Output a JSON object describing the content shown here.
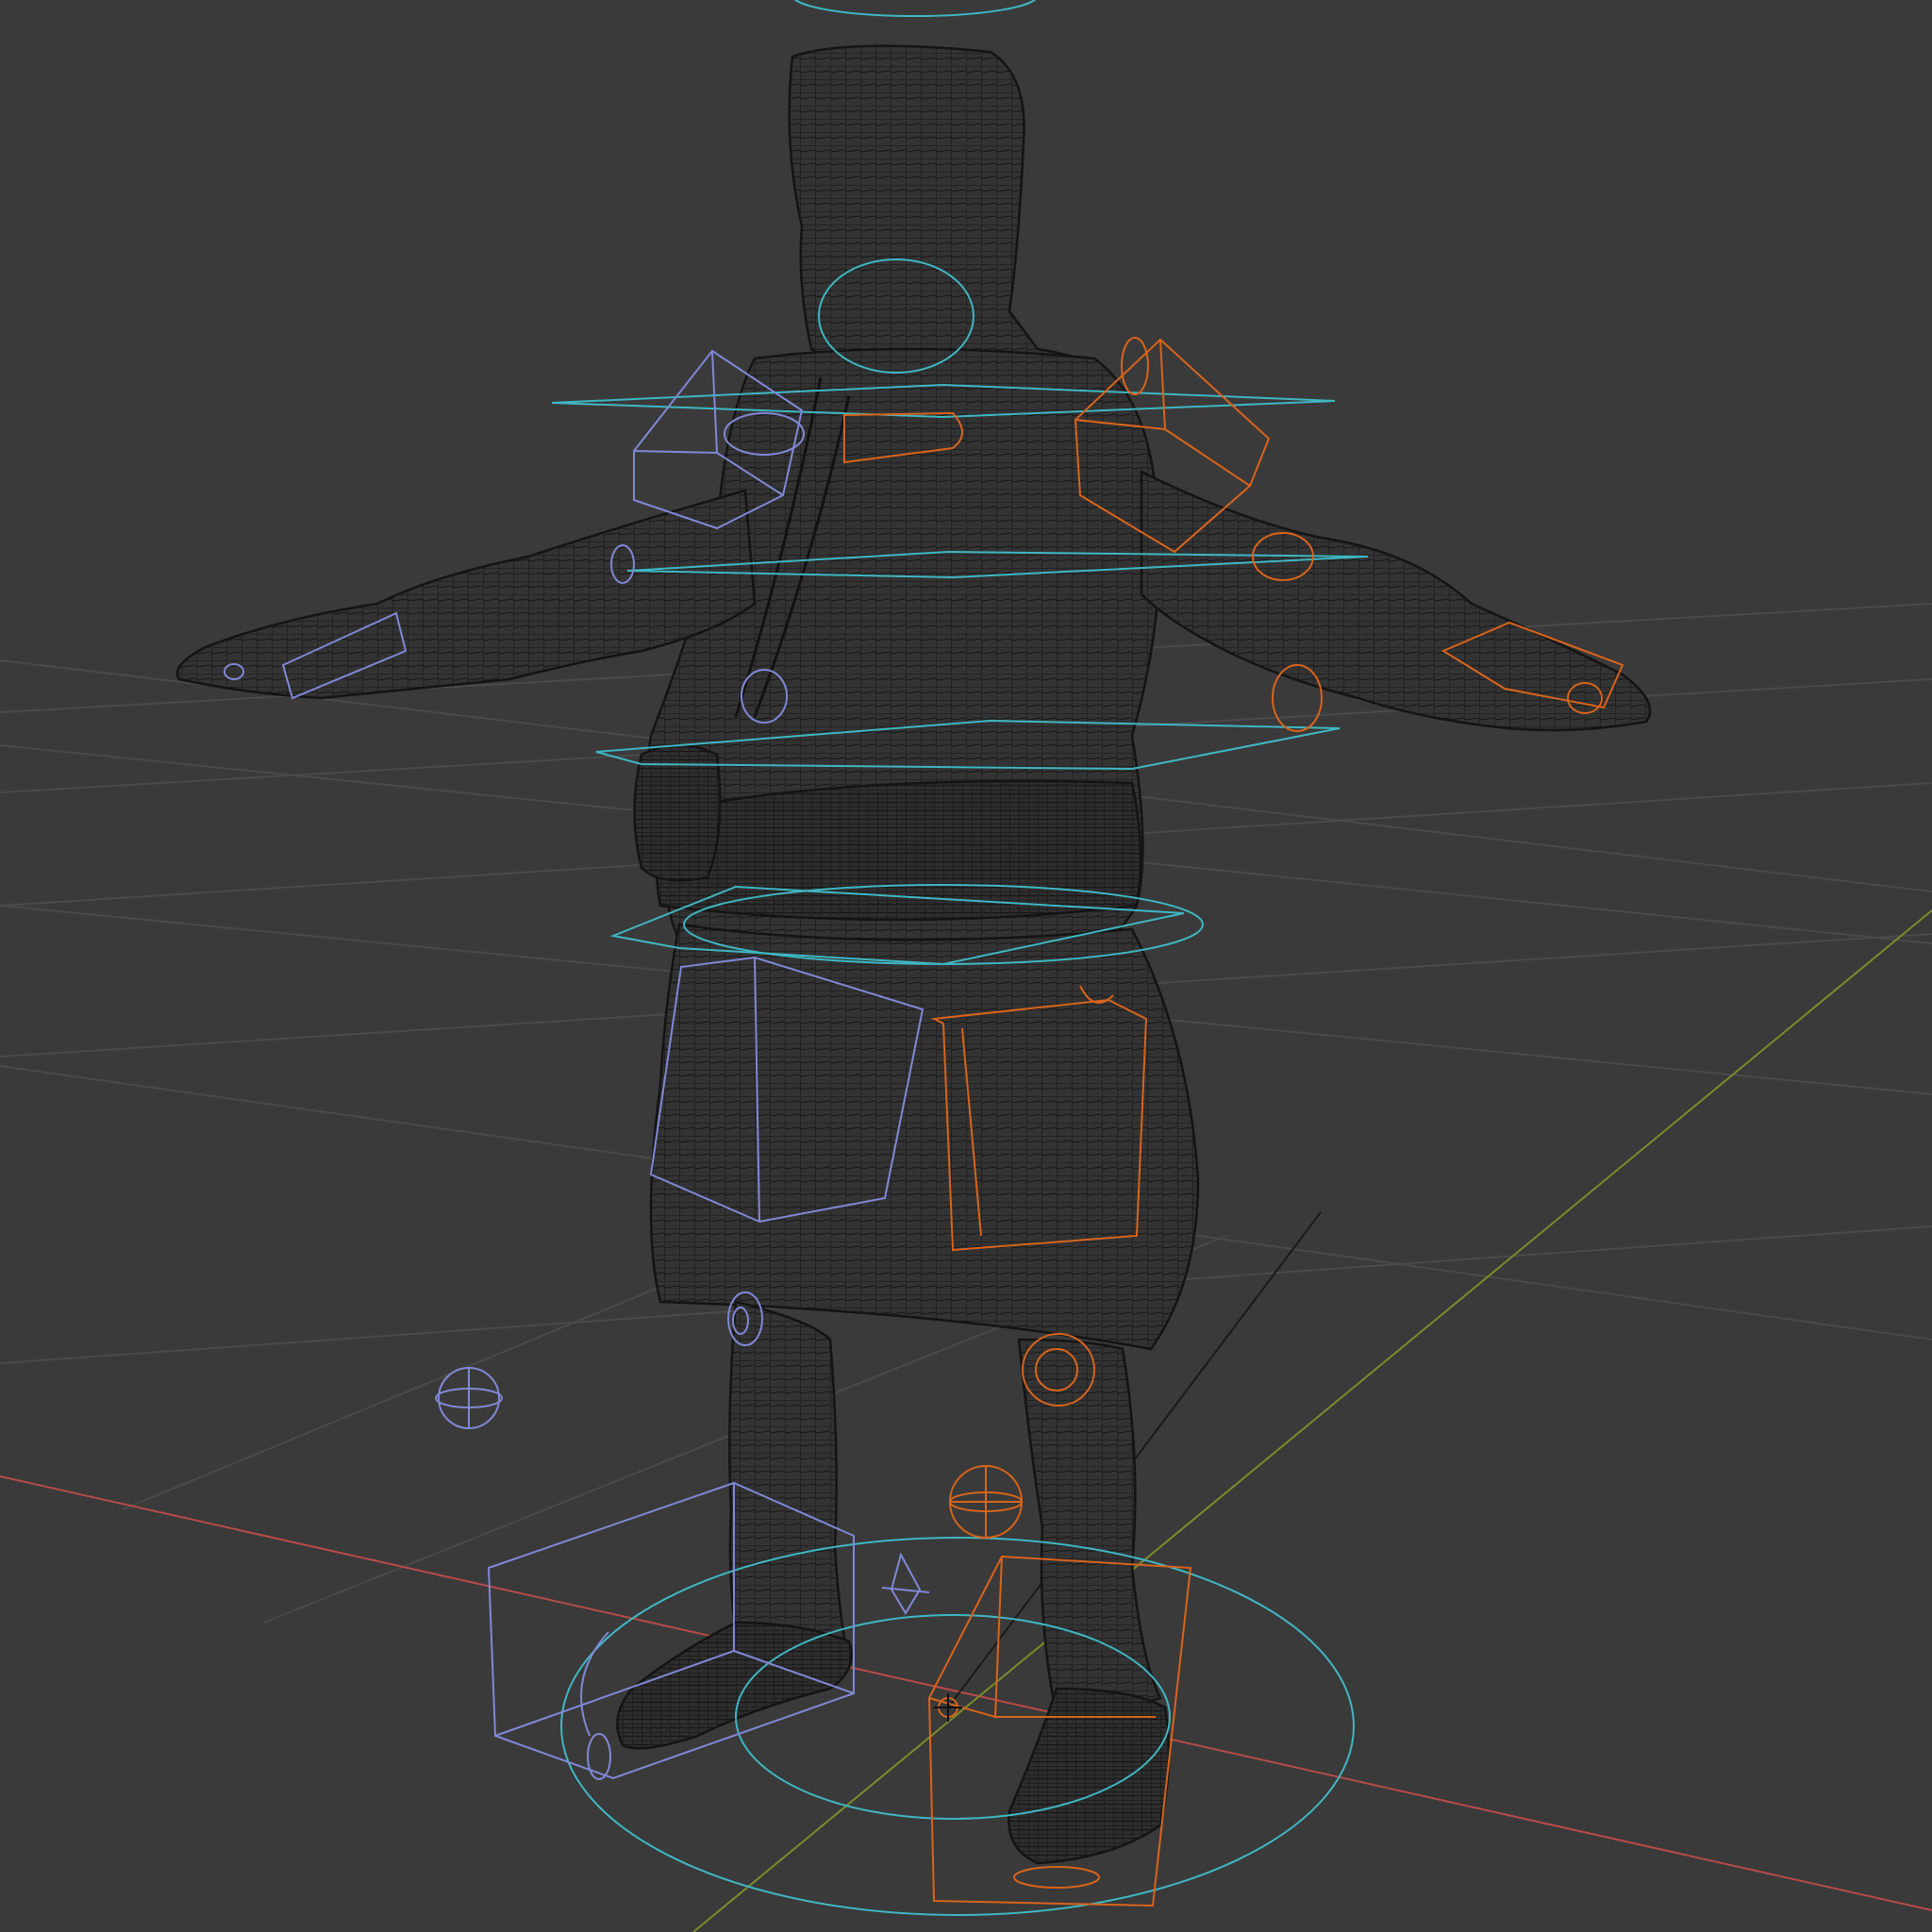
{
  "viewport": {
    "background_color": "#3a3a3a",
    "grid_color": "#4a4a4a",
    "x_axis_color": "#b84a4a",
    "y_axis_color": "#7a8c2a",
    "mesh_color": "#141414",
    "control_colors": {
      "center": "#3fb7c2",
      "left_side": "#8088d6",
      "right_side": "#d8641c"
    },
    "shading_mode": "wireframe",
    "subject": "rigged-character-mesh"
  }
}
